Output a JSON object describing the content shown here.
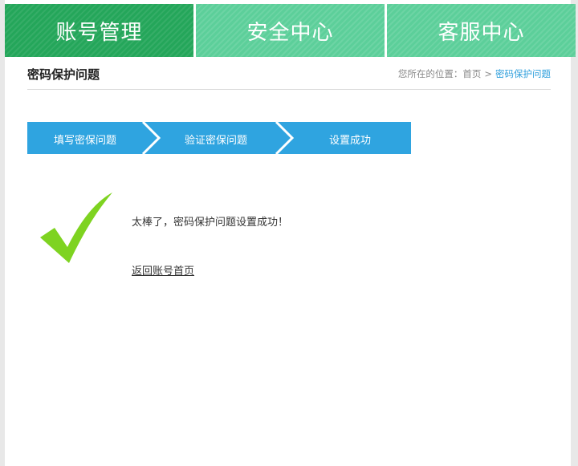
{
  "tabs": [
    {
      "label": "账号管理",
      "active": true
    },
    {
      "label": "安全中心",
      "active": false
    },
    {
      "label": "客服中心",
      "active": false
    }
  ],
  "page": {
    "title": "密码保护问题"
  },
  "breadcrumb": {
    "prefix": "您所在的位置：",
    "home": "首页",
    "separator": ">",
    "current": "密码保护问题"
  },
  "steps": [
    {
      "label": "填写密保问题"
    },
    {
      "label": "验证密保问题"
    },
    {
      "label": "设置成功"
    }
  ],
  "result": {
    "message": "太棒了，密码保护问题设置成功！",
    "back_link": "返回账号首页"
  },
  "colors": {
    "tab_active": "#24a65a",
    "tab_inactive": "#5ccf9a",
    "step_blue": "#2fa4e0",
    "check_green": "#7ed321",
    "link_blue": "#2f9fdc"
  },
  "icons": {
    "success": "checkmark-icon"
  }
}
